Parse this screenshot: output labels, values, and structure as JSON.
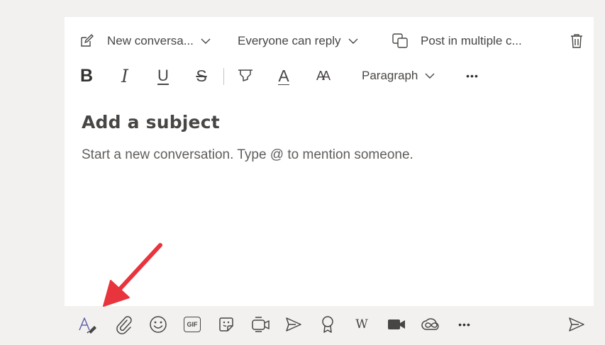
{
  "compose": {
    "conversation_type": "New conversa...",
    "reply_setting": "Everyone can reply",
    "post_multiple": "Post in multiple c...",
    "subject_placeholder": "Add a subject",
    "body_placeholder": "Start a new conversation. Type @ to mention someone."
  },
  "format_toolbar": {
    "bold": "B",
    "italic": "I",
    "underline": "U",
    "strike": "S",
    "font_color": "A",
    "font_size": "AA",
    "paragraph": "Paragraph",
    "more": "•••"
  },
  "bottom_toolbar": {
    "gif": "GIF",
    "wikipedia": "W",
    "more": "•••"
  },
  "colors": {
    "annotation_arrow": "#e8343d",
    "accent": "#6264a7",
    "icon": "#484644"
  }
}
